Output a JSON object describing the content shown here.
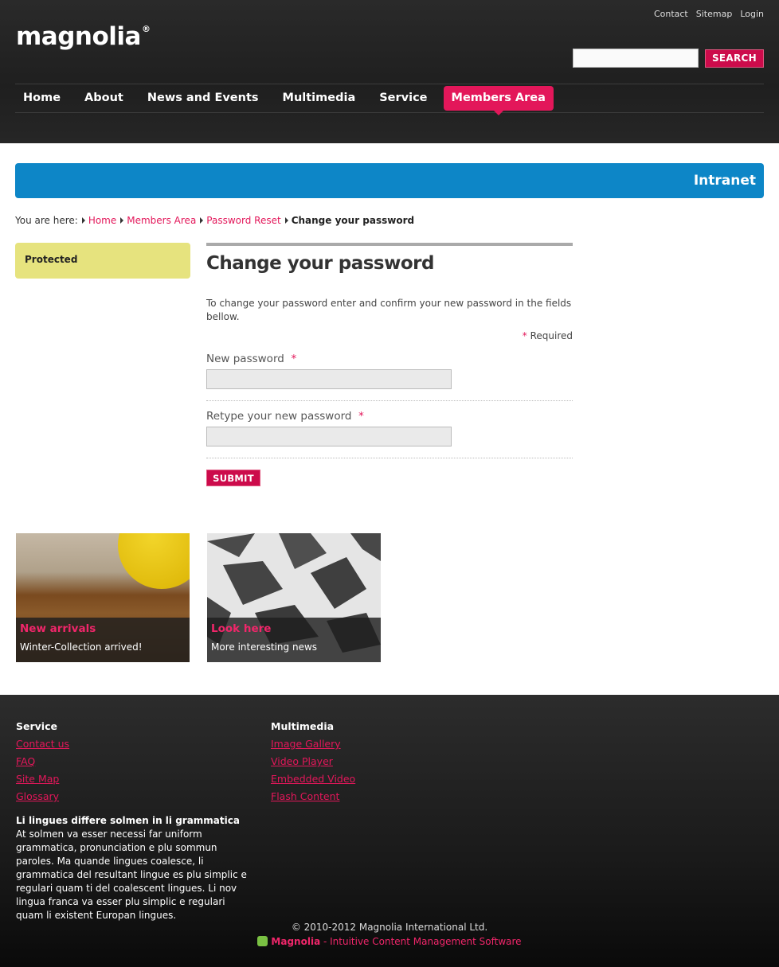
{
  "header": {
    "logo": "magnolia",
    "logo_mark": "®",
    "topnav": [
      "Contact",
      "Sitemap",
      "Login"
    ],
    "search_button": "SEARCH",
    "nav": [
      "Home",
      "About",
      "News and Events",
      "Multimedia",
      "Service",
      "Members Area"
    ],
    "active_nav": "Members Area"
  },
  "banner": {
    "title": "Intranet",
    "color": "#0d86c7"
  },
  "breadcrumb": {
    "prefix": "You are here:",
    "links": [
      "Home",
      "Members Area",
      "Password Reset"
    ],
    "current": "Change your password"
  },
  "sidebar": {
    "protected": "Protected"
  },
  "form": {
    "title": "Change your password",
    "intro": "To change your password enter and confirm your new password in the fields bellow.",
    "required_mark": "*",
    "required_label": "Required",
    "field1_label": "New password",
    "field2_label": "Retype your new password",
    "submit": "SUBMIT"
  },
  "teasers": [
    {
      "title": "New arrivals",
      "subtitle": "Winter-Collection arrived!"
    },
    {
      "title": "Look here",
      "subtitle": "More interesting news"
    }
  ],
  "footer": {
    "col1_title": "Service",
    "col1_links": [
      "Contact us",
      "FAQ",
      "Site Map",
      "Glossary"
    ],
    "col2_title": "Multimedia",
    "col2_links": [
      "Image Gallery",
      "Video Player",
      "Embedded Video",
      "Flash Content"
    ],
    "text_title": "Li lingues differe solmen in li grammatica",
    "text_body": "At solmen va esser necessi far uniform grammatica, pronunciation e plu sommun paroles. Ma quande lingues coalesce, li grammatica del resultant lingue es plu simplic e regulari quam ti del coalescent lingues. Li nov lingua franca va esser plu simplic e regulari quam li existent Europan lingues.",
    "copyright": "© 2010-2012 Magnolia International Ltd.",
    "powered_brand": "Magnolia",
    "powered_tag": " - Intuitive Content Management Software"
  },
  "colors": {
    "accent": "#e3175a",
    "protected_bg": "#e6e37e"
  }
}
